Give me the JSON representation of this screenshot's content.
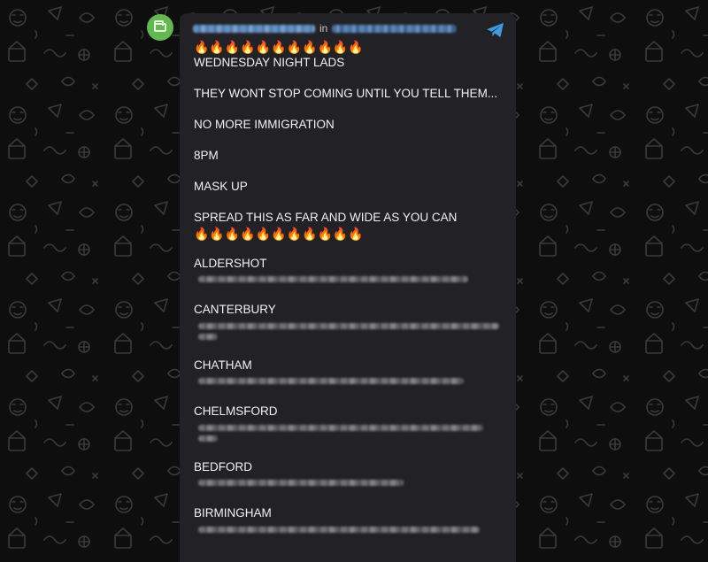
{
  "header": {
    "in_word": "in"
  },
  "message": {
    "fires_top": "🔥🔥🔥🔥🔥🔥🔥🔥🔥🔥🔥",
    "line1": "WEDNESDAY NIGHT LADS",
    "line2": "THEY WONT STOP COMING UNTIL YOU TELL THEM...",
    "line3": "NO MORE IMMIGRATION",
    "line4": "8PM",
    "line5": "MASK UP",
    "line6": "SPREAD THIS AS FAR AND WIDE AS YOU CAN",
    "fires_bottom": "🔥🔥🔥🔥🔥🔥🔥🔥🔥🔥🔥",
    "cities": [
      "ALDERSHOT",
      "CANTERBURY",
      "CHATHAM",
      "CHELMSFORD",
      "BEDFORD",
      "BIRMINGHAM"
    ]
  },
  "icons": {
    "avatar": "folder-icon",
    "send": "telegram-plane-icon"
  },
  "colors": {
    "background": "#0e0e0e",
    "bubble": "#222226",
    "avatar": "#63b84f",
    "accent": "#3f9ae0",
    "text": "#f2f2f2"
  }
}
